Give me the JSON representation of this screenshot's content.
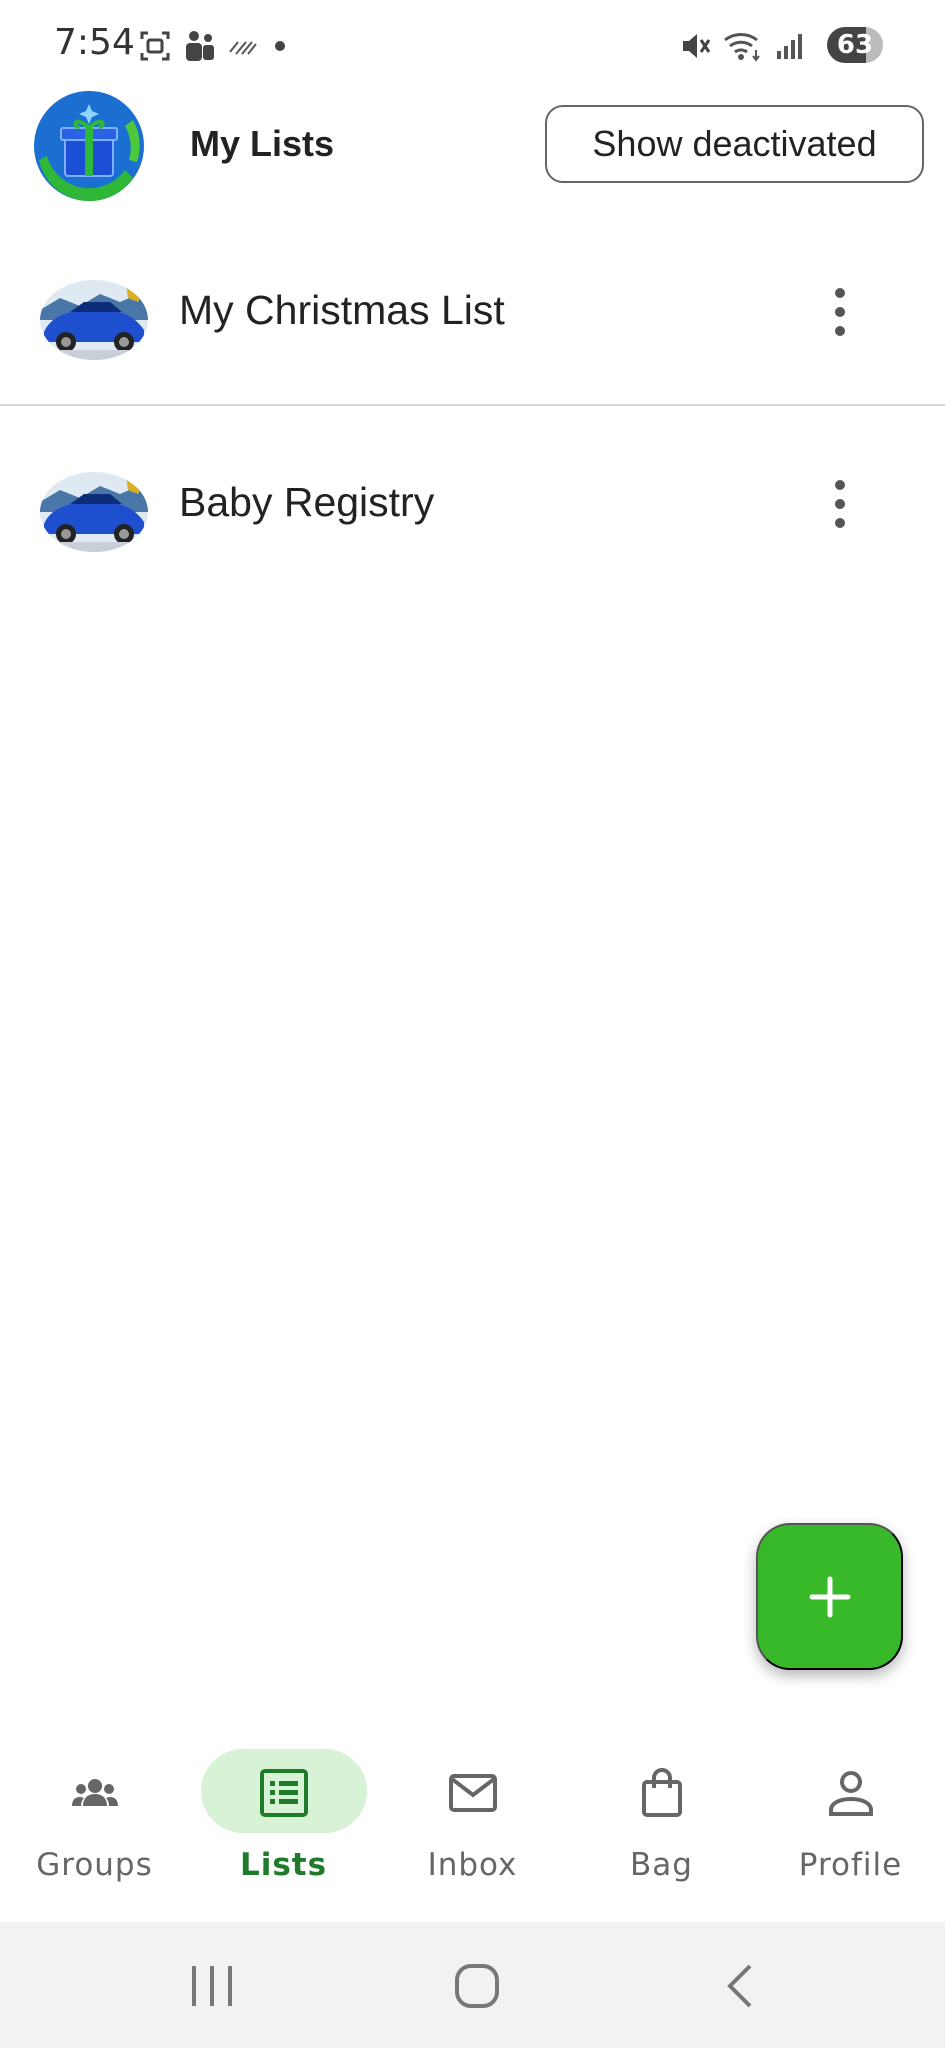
{
  "status_bar": {
    "time": "7:54",
    "battery": "63",
    "left_icons": [
      "screenshot-icon",
      "teams-icon",
      "glare-icon",
      "dot-icon"
    ],
    "right_icons": [
      "mute-icon",
      "wifi-icon",
      "signal-icon"
    ]
  },
  "header": {
    "title": "My Lists",
    "show_deactivated_label": "Show deactivated",
    "logo_icon": "gift-logo-icon"
  },
  "lists": [
    {
      "name": "My Christmas List",
      "avatar": "blue-car-image"
    },
    {
      "name": "Baby Registry",
      "avatar": "blue-car-image"
    }
  ],
  "fab": {
    "icon": "plus-icon",
    "color": "#37b929"
  },
  "bottom_nav": {
    "items": [
      {
        "label": "Groups",
        "icon": "groups-icon",
        "active": false
      },
      {
        "label": "Lists",
        "icon": "list-icon",
        "active": true
      },
      {
        "label": "Inbox",
        "icon": "mail-icon",
        "active": false
      },
      {
        "label": "Bag",
        "icon": "bag-icon",
        "active": false
      },
      {
        "label": "Profile",
        "icon": "person-icon",
        "active": false
      }
    ],
    "active_color": "#1f7a2a",
    "active_pill_color": "#d8f2d6"
  },
  "system_nav": {
    "buttons": [
      "recent-apps-icon",
      "home-icon",
      "back-icon"
    ]
  }
}
